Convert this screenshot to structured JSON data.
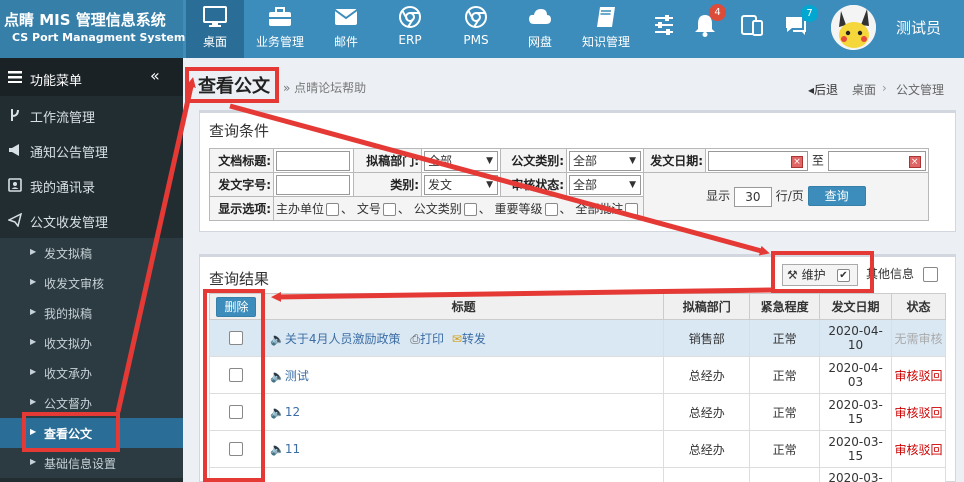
{
  "brand": {
    "title": "点睛 MIS 管理信息系统",
    "subtitle": "CS Port Managment System"
  },
  "nav": [
    {
      "label": "桌面",
      "icon": "monitor-icon"
    },
    {
      "label": "业务管理",
      "icon": "briefcase-icon"
    },
    {
      "label": "邮件",
      "icon": "envelope-icon"
    },
    {
      "label": "ERP",
      "icon": "chrome-icon"
    },
    {
      "label": "PMS",
      "icon": "chrome-icon"
    },
    {
      "label": "网盘",
      "icon": "cloud-icon"
    },
    {
      "label": "知识管理",
      "icon": "book-icon"
    }
  ],
  "tools": {
    "bell_count": "4",
    "chat_count": "7"
  },
  "user": {
    "name": "测试员"
  },
  "sidebar": {
    "header": "功能菜单",
    "items": [
      "工作流管理",
      "通知公告管理",
      "我的通讯录",
      "公文收发管理"
    ],
    "subitems": [
      "发文拟稿",
      "收发文审核",
      "我的拟稿",
      "收文拟办",
      "收文承办",
      "公文督办",
      "查看公文",
      "基础信息设置"
    ]
  },
  "page": {
    "title": "查看公文",
    "subtitle": "点晴论坛帮助"
  },
  "breadcrumb": {
    "back": "后退",
    "home": "桌面",
    "current": "公文管理"
  },
  "query": {
    "panel_title": "查询条件",
    "doc_title_label": "文档标题:",
    "dept_label": "拟稿部门:",
    "dept_value": "全部",
    "category_label": "公文类别:",
    "category_value": "全部",
    "date_label": "发文日期:",
    "date_to": "至",
    "docno_label": "发文字号:",
    "type_label": "类别:",
    "type_value": "发文",
    "audit_label": "审核状态:",
    "audit_value": "全部",
    "show_prefix": "显示",
    "page_size": "30",
    "show_suffix": "行/页",
    "search_button": "查询",
    "options_label": "显示选项:",
    "options": [
      "主办单位",
      "文号",
      "公文类别",
      "重要等级",
      "全部批注"
    ]
  },
  "results": {
    "panel_title": "查询结果",
    "maintain_label": "维护",
    "other_info_label": "其他信息",
    "delete_button": "删除",
    "columns": [
      "标题",
      "拟稿部门",
      "紧急程度",
      "发文日期",
      "状态"
    ],
    "print_label": "打印",
    "forward_label": "转发",
    "rows": [
      {
        "title": "关于4月人员激励政策",
        "dept": "销售部",
        "urgency": "正常",
        "date1": "2020-04-",
        "date2": "10",
        "status": "无需审核"
      },
      {
        "title": "测试",
        "dept": "总经办",
        "urgency": "正常",
        "date1": "2020-04-",
        "date2": "03",
        "status": "审核驳回"
      },
      {
        "title": "12",
        "dept": "总经办",
        "urgency": "正常",
        "date1": "2020-03-",
        "date2": "15",
        "status": "审核驳回"
      },
      {
        "title": "11",
        "dept": "总经办",
        "urgency": "正常",
        "date1": "2020-03-",
        "date2": "15",
        "status": "审核驳回"
      },
      {
        "title": "",
        "dept": "",
        "urgency": "",
        "date1": "2020-03-",
        "date2": "",
        "status": ""
      }
    ]
  },
  "colors": {
    "header": "#3c8dbc",
    "sidebar": "#222d32",
    "highlight": "#e53935",
    "link": "#3c6ea5",
    "reject": "#cc0000",
    "noaudit": "#aaaaaa"
  }
}
